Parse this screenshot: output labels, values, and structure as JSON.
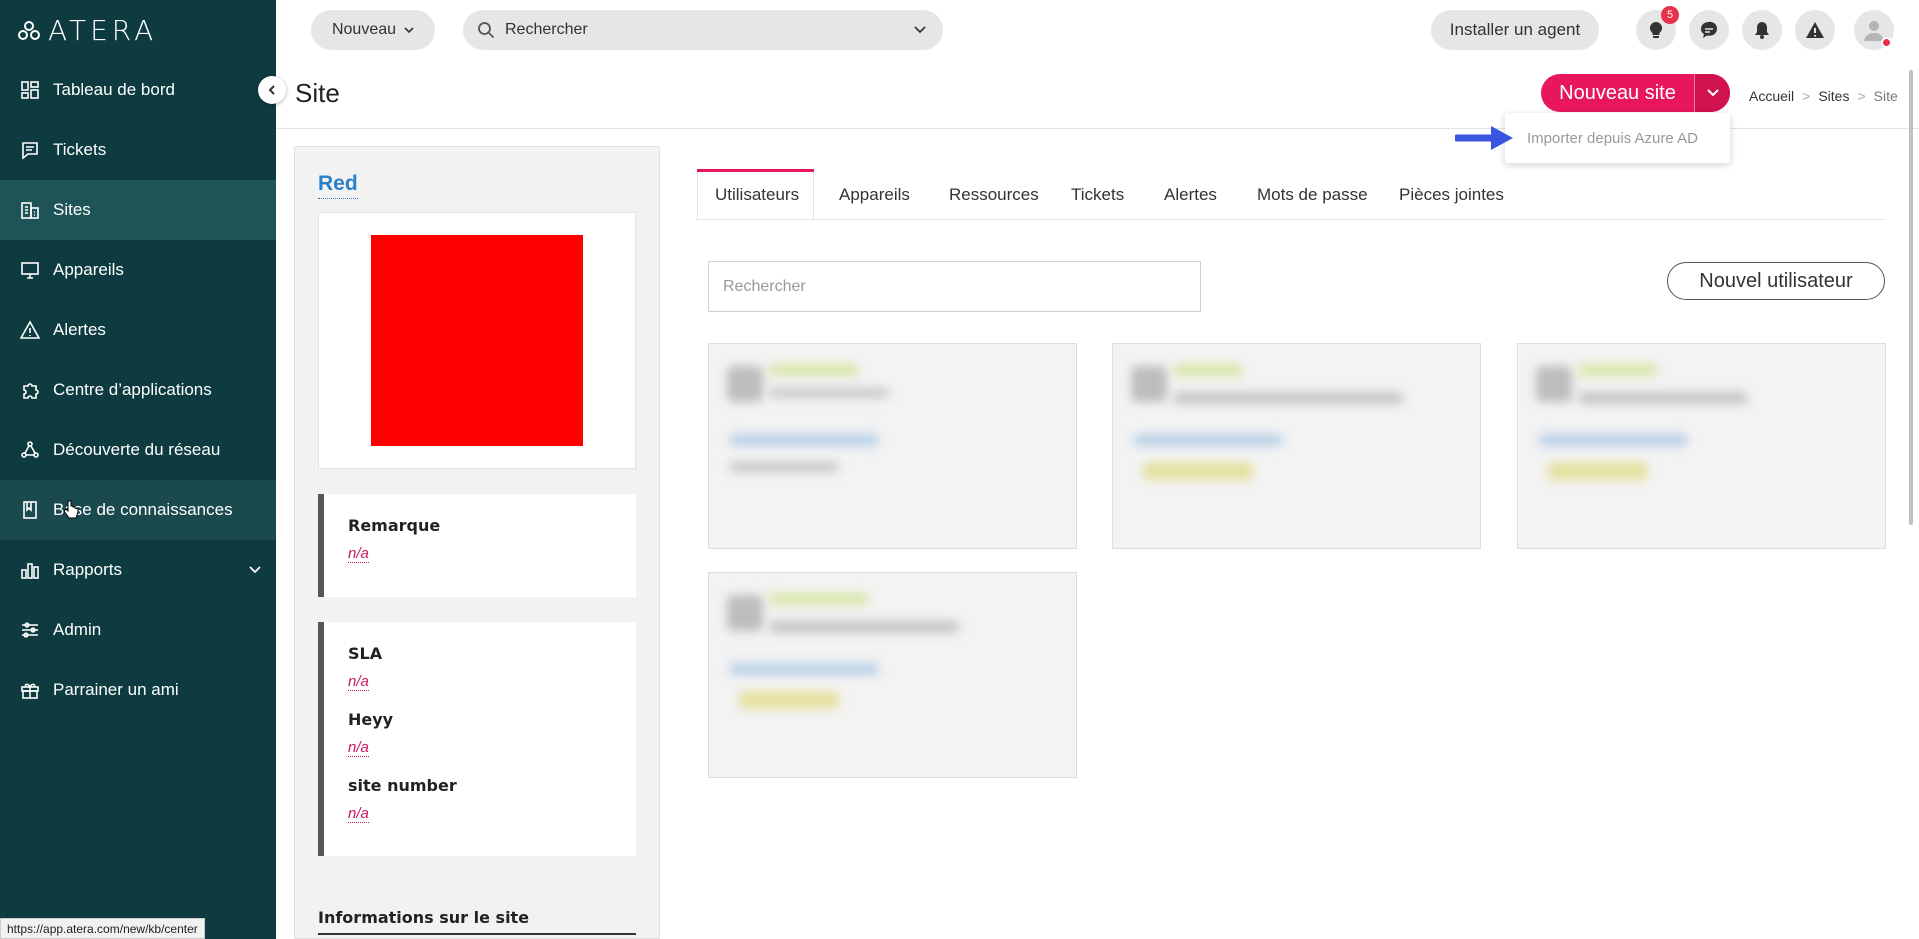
{
  "app": {
    "brand": "ATERA"
  },
  "sidebar": {
    "items": [
      {
        "label": "Tableau de bord",
        "icon": "dashboard-icon"
      },
      {
        "label": "Tickets",
        "icon": "ticket-icon"
      },
      {
        "label": "Sites",
        "icon": "building-icon"
      },
      {
        "label": "Appareils",
        "icon": "monitor-icon"
      },
      {
        "label": "Alertes",
        "icon": "warning-icon"
      },
      {
        "label": "Centre d’applications",
        "icon": "puzzle-icon"
      },
      {
        "label": "Découverte du réseau",
        "icon": "network-icon"
      },
      {
        "label": "Base de connaissances",
        "icon": "book-icon"
      },
      {
        "label": "Rapports",
        "icon": "chart-icon"
      },
      {
        "label": "Admin",
        "icon": "sliders-icon"
      },
      {
        "label": "Parrainer un ami",
        "icon": "gift-icon"
      }
    ]
  },
  "topbar": {
    "new_label": "Nouveau",
    "search_placeholder": "Rechercher",
    "install_label": "Installer un agent",
    "notification_count": "5"
  },
  "page": {
    "title": "Site",
    "new_site_label": "Nouveau site",
    "dropdown_item": "Importer depuis Azure AD",
    "breadcrumb": [
      "Accueil",
      "Sites",
      "Site"
    ]
  },
  "site": {
    "name": "Red",
    "remark_label": "Remarque",
    "remark_value": "n/a",
    "fields": [
      {
        "label": "SLA",
        "value": "n/a"
      },
      {
        "label": "Heyy",
        "value": "n/a"
      },
      {
        "label": "site number",
        "value": "n/a"
      }
    ],
    "info_section": "Informations sur le site"
  },
  "tabs": [
    "Utilisateurs",
    "Appareils",
    "Ressources",
    "Tickets",
    "Alertes",
    "Mots de passe",
    "Pièces jointes"
  ],
  "users": {
    "search_placeholder": "Rechercher",
    "new_user_label": "Nouvel utilisateur"
  },
  "status_url": "https://app.atera.com/new/kb/center",
  "colors": {
    "sidebar": "#0d3b3f",
    "accent": "#e8175d",
    "link": "#2a7fc9"
  }
}
